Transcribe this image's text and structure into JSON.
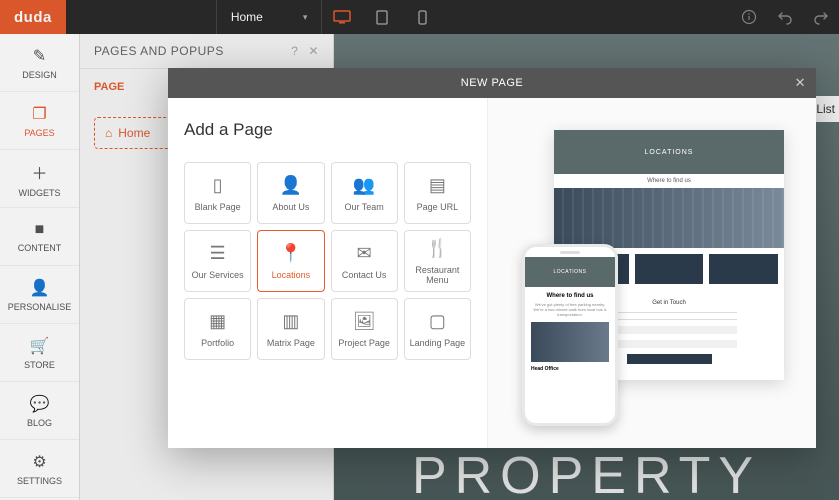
{
  "logo": "duda",
  "topbar": {
    "page_selector": "Home"
  },
  "sidebar": {
    "items": [
      {
        "label": "DESIGN"
      },
      {
        "label": "PAGES"
      },
      {
        "label": "WIDGETS"
      },
      {
        "label": "CONTENT"
      },
      {
        "label": "PERSONALISE"
      },
      {
        "label": "STORE"
      },
      {
        "label": "BLOG"
      },
      {
        "label": "SETTINGS"
      }
    ]
  },
  "panel": {
    "title": "PAGES AND POPUPS",
    "tab": "PAGE",
    "home_item": "Home"
  },
  "canvas": {
    "hero": "PROPERTY",
    "list_btn": "List"
  },
  "modal": {
    "header": "NEW PAGE",
    "title": "Add a Page",
    "tiles": [
      {
        "label": "Blank Page"
      },
      {
        "label": "About Us"
      },
      {
        "label": "Our Team"
      },
      {
        "label": "Page URL"
      },
      {
        "label": "Our Services"
      },
      {
        "label": "Locations"
      },
      {
        "label": "Contact Us"
      },
      {
        "label": "Restaurant Menu"
      },
      {
        "label": "Portfolio"
      },
      {
        "label": "Matrix Page"
      },
      {
        "label": "Project Page"
      },
      {
        "label": "Landing Page"
      }
    ],
    "preview": {
      "hero": "LOCATIONS",
      "strip": "Where to find us",
      "form_title": "Get in Touch",
      "phone_hero": "LOCATIONS",
      "phone_h": "Where to find us",
      "phone_t": "We've got plenty of free parking nearby. We're a two-minute walk from local bus & transportation.",
      "phone_label": "Head Office"
    }
  }
}
